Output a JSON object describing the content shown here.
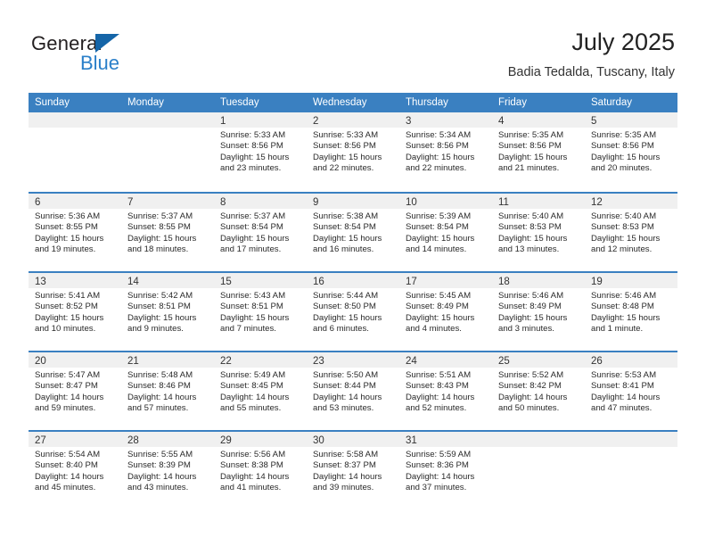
{
  "brand": {
    "name_top": "General",
    "name_bottom": "Blue",
    "triangle_color": "#1565a8",
    "blue_color": "#2a7fc9"
  },
  "header": {
    "title": "July 2025",
    "subtitle": "Badia Tedalda, Tuscany, Italy"
  },
  "theme": {
    "header_blue": "#3a80c1",
    "day_band_gray": "#f0f0f0"
  },
  "weekdays": [
    "Sunday",
    "Monday",
    "Tuesday",
    "Wednesday",
    "Thursday",
    "Friday",
    "Saturday"
  ],
  "weeks": [
    [
      {
        "day": "",
        "sunrise": "",
        "sunset": "",
        "daylight": ""
      },
      {
        "day": "",
        "sunrise": "",
        "sunset": "",
        "daylight": ""
      },
      {
        "day": "1",
        "sunrise": "Sunrise: 5:33 AM",
        "sunset": "Sunset: 8:56 PM",
        "daylight": "Daylight: 15 hours and 23 minutes."
      },
      {
        "day": "2",
        "sunrise": "Sunrise: 5:33 AM",
        "sunset": "Sunset: 8:56 PM",
        "daylight": "Daylight: 15 hours and 22 minutes."
      },
      {
        "day": "3",
        "sunrise": "Sunrise: 5:34 AM",
        "sunset": "Sunset: 8:56 PM",
        "daylight": "Daylight: 15 hours and 22 minutes."
      },
      {
        "day": "4",
        "sunrise": "Sunrise: 5:35 AM",
        "sunset": "Sunset: 8:56 PM",
        "daylight": "Daylight: 15 hours and 21 minutes."
      },
      {
        "day": "5",
        "sunrise": "Sunrise: 5:35 AM",
        "sunset": "Sunset: 8:56 PM",
        "daylight": "Daylight: 15 hours and 20 minutes."
      }
    ],
    [
      {
        "day": "6",
        "sunrise": "Sunrise: 5:36 AM",
        "sunset": "Sunset: 8:55 PM",
        "daylight": "Daylight: 15 hours and 19 minutes."
      },
      {
        "day": "7",
        "sunrise": "Sunrise: 5:37 AM",
        "sunset": "Sunset: 8:55 PM",
        "daylight": "Daylight: 15 hours and 18 minutes."
      },
      {
        "day": "8",
        "sunrise": "Sunrise: 5:37 AM",
        "sunset": "Sunset: 8:54 PM",
        "daylight": "Daylight: 15 hours and 17 minutes."
      },
      {
        "day": "9",
        "sunrise": "Sunrise: 5:38 AM",
        "sunset": "Sunset: 8:54 PM",
        "daylight": "Daylight: 15 hours and 16 minutes."
      },
      {
        "day": "10",
        "sunrise": "Sunrise: 5:39 AM",
        "sunset": "Sunset: 8:54 PM",
        "daylight": "Daylight: 15 hours and 14 minutes."
      },
      {
        "day": "11",
        "sunrise": "Sunrise: 5:40 AM",
        "sunset": "Sunset: 8:53 PM",
        "daylight": "Daylight: 15 hours and 13 minutes."
      },
      {
        "day": "12",
        "sunrise": "Sunrise: 5:40 AM",
        "sunset": "Sunset: 8:53 PM",
        "daylight": "Daylight: 15 hours and 12 minutes."
      }
    ],
    [
      {
        "day": "13",
        "sunrise": "Sunrise: 5:41 AM",
        "sunset": "Sunset: 8:52 PM",
        "daylight": "Daylight: 15 hours and 10 minutes."
      },
      {
        "day": "14",
        "sunrise": "Sunrise: 5:42 AM",
        "sunset": "Sunset: 8:51 PM",
        "daylight": "Daylight: 15 hours and 9 minutes."
      },
      {
        "day": "15",
        "sunrise": "Sunrise: 5:43 AM",
        "sunset": "Sunset: 8:51 PM",
        "daylight": "Daylight: 15 hours and 7 minutes."
      },
      {
        "day": "16",
        "sunrise": "Sunrise: 5:44 AM",
        "sunset": "Sunset: 8:50 PM",
        "daylight": "Daylight: 15 hours and 6 minutes."
      },
      {
        "day": "17",
        "sunrise": "Sunrise: 5:45 AM",
        "sunset": "Sunset: 8:49 PM",
        "daylight": "Daylight: 15 hours and 4 minutes."
      },
      {
        "day": "18",
        "sunrise": "Sunrise: 5:46 AM",
        "sunset": "Sunset: 8:49 PM",
        "daylight": "Daylight: 15 hours and 3 minutes."
      },
      {
        "day": "19",
        "sunrise": "Sunrise: 5:46 AM",
        "sunset": "Sunset: 8:48 PM",
        "daylight": "Daylight: 15 hours and 1 minute."
      }
    ],
    [
      {
        "day": "20",
        "sunrise": "Sunrise: 5:47 AM",
        "sunset": "Sunset: 8:47 PM",
        "daylight": "Daylight: 14 hours and 59 minutes."
      },
      {
        "day": "21",
        "sunrise": "Sunrise: 5:48 AM",
        "sunset": "Sunset: 8:46 PM",
        "daylight": "Daylight: 14 hours and 57 minutes."
      },
      {
        "day": "22",
        "sunrise": "Sunrise: 5:49 AM",
        "sunset": "Sunset: 8:45 PM",
        "daylight": "Daylight: 14 hours and 55 minutes."
      },
      {
        "day": "23",
        "sunrise": "Sunrise: 5:50 AM",
        "sunset": "Sunset: 8:44 PM",
        "daylight": "Daylight: 14 hours and 53 minutes."
      },
      {
        "day": "24",
        "sunrise": "Sunrise: 5:51 AM",
        "sunset": "Sunset: 8:43 PM",
        "daylight": "Daylight: 14 hours and 52 minutes."
      },
      {
        "day": "25",
        "sunrise": "Sunrise: 5:52 AM",
        "sunset": "Sunset: 8:42 PM",
        "daylight": "Daylight: 14 hours and 50 minutes."
      },
      {
        "day": "26",
        "sunrise": "Sunrise: 5:53 AM",
        "sunset": "Sunset: 8:41 PM",
        "daylight": "Daylight: 14 hours and 47 minutes."
      }
    ],
    [
      {
        "day": "27",
        "sunrise": "Sunrise: 5:54 AM",
        "sunset": "Sunset: 8:40 PM",
        "daylight": "Daylight: 14 hours and 45 minutes."
      },
      {
        "day": "28",
        "sunrise": "Sunrise: 5:55 AM",
        "sunset": "Sunset: 8:39 PM",
        "daylight": "Daylight: 14 hours and 43 minutes."
      },
      {
        "day": "29",
        "sunrise": "Sunrise: 5:56 AM",
        "sunset": "Sunset: 8:38 PM",
        "daylight": "Daylight: 14 hours and 41 minutes."
      },
      {
        "day": "30",
        "sunrise": "Sunrise: 5:58 AM",
        "sunset": "Sunset: 8:37 PM",
        "daylight": "Daylight: 14 hours and 39 minutes."
      },
      {
        "day": "31",
        "sunrise": "Sunrise: 5:59 AM",
        "sunset": "Sunset: 8:36 PM",
        "daylight": "Daylight: 14 hours and 37 minutes."
      },
      {
        "day": "",
        "sunrise": "",
        "sunset": "",
        "daylight": ""
      },
      {
        "day": "",
        "sunrise": "",
        "sunset": "",
        "daylight": ""
      }
    ]
  ]
}
